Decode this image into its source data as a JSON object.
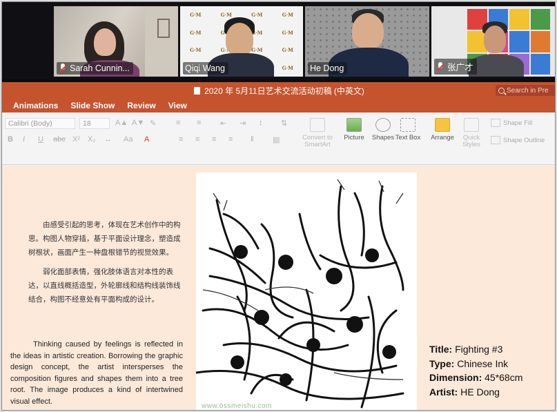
{
  "participants": [
    {
      "name": "Sarah Cunnin...",
      "muted": true
    },
    {
      "name": "Qiqi Wang",
      "muted": false
    },
    {
      "name": "He Dong",
      "muted": false
    },
    {
      "name": "张广才",
      "muted": true
    }
  ],
  "backdrop_logo": "G·M",
  "ppt": {
    "title": "2020 年 5月11日艺术交流活动初稿 (中英文)",
    "search_placeholder": "Search in Pre",
    "tabs": [
      "Animations",
      "Slide Show",
      "Review",
      "View"
    ],
    "font_name": "Calibri (Body)",
    "font_size": "18",
    "buttons": {
      "convert": "Convert to SmartArt",
      "picture": "Picture",
      "shapes": "Shapes",
      "textbox": "Text Box",
      "arrange": "Arrange",
      "quick_styles": "Quick Styles",
      "shape_fill": "Shape Fill",
      "shape_outline": "Shape Outline"
    }
  },
  "slide": {
    "cn_paragraphs": [
      "由感受引起的思考，体现在艺术创作中的构思。构图人物穿插，基于平面设计理念，塑造成树根状，画面产生一种盘根错节的视觉效果。",
      "弱化面部表情，强化肢体语言对本性的表达，以直线概括造型，外轮廓线和结构线装饰线结合，构图不经意处有平面构成的设计。"
    ],
    "en_paragraph": "Thinking caused by feelings is reflected in the ideas in artistic creation. Borrowing the graphic design concept, the artist intersperses the composition figures and shapes them into a tree root. The image produces a kind of intertwined visual effect.",
    "watermark": "www.ossmeishu.com",
    "info": {
      "title_label": "Title:",
      "title_value": "Fighting #3",
      "type_label": "Type:",
      "type_value": "Chinese Ink",
      "dimension_label": "Dimension:",
      "dimension_value": "45*68cm",
      "artist_label": "Artist:",
      "artist_value": "HE Dong"
    }
  },
  "colors": {
    "ribbon_accent": "#c5532e",
    "slide_bg": "#fde9da"
  }
}
